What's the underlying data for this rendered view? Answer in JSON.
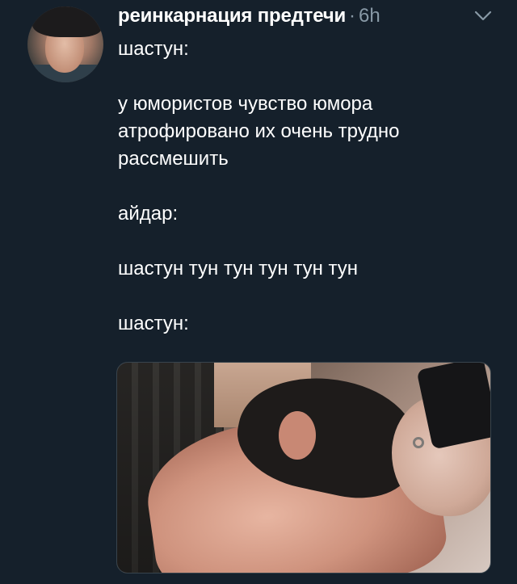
{
  "tweet": {
    "display_name": "реинкарнация предтечи",
    "separator": "·",
    "timestamp": "6h",
    "lines": [
      "шастун:",
      "у юмористов чувство юмора атрофировано их очень трудно рассмешить",
      "айдар:",
      "шастун тун тун тун тун тун",
      "шастун:"
    ]
  },
  "icons": {
    "menu": "chevron-down-icon",
    "avatar": "profile-photo"
  },
  "colors": {
    "background": "#15202b",
    "text": "#ffffff",
    "secondary_text": "#8899a6",
    "media_border": "#38444d"
  }
}
